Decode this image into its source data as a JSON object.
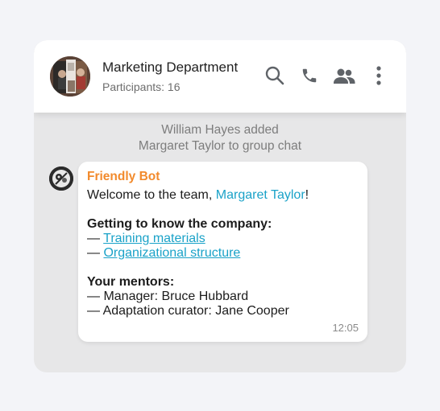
{
  "header": {
    "title": "Marketing Department",
    "participants": "Participants: 16",
    "icons": [
      "search-icon",
      "phone-icon",
      "group-icon",
      "more-vertical-icon"
    ]
  },
  "system_message": {
    "line1": "William Hayes added",
    "line2": "Margaret Taylor to group chat"
  },
  "message": {
    "sender": "Friendly Bot",
    "welcome_prefix": "Welcome to the team, ",
    "welcome_mention": "Margaret Taylor",
    "welcome_suffix": "!",
    "section1_title": "Getting to know the company:",
    "dash": "— ",
    "link1": "Training materials",
    "link2": "Organizational structure",
    "section2_title": "Your mentors:",
    "mentor1": "— Manager: Bruce Hubbard",
    "mentor2": "— Adaptation curator: Jane Cooper",
    "time": "12:05"
  },
  "colors": {
    "sender": "#f28a2c",
    "link": "#1aa2c8",
    "icon": "#5f6368"
  }
}
